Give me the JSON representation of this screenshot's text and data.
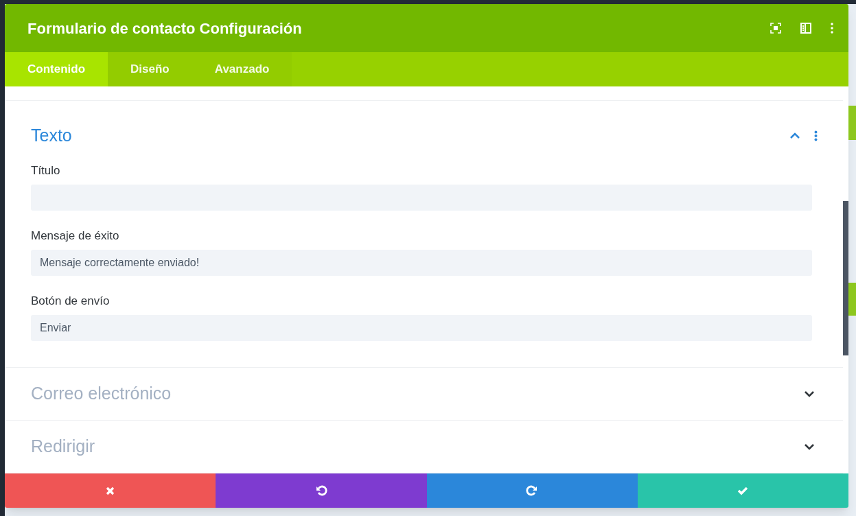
{
  "window": {
    "title": "Formulario de contacto Configuración"
  },
  "tabs": [
    {
      "label": "Contenido",
      "selected": true
    },
    {
      "label": "Diseño",
      "selected": false
    },
    {
      "label": "Avanzado",
      "selected": false
    }
  ],
  "sections": [
    {
      "title": "Texto",
      "expanded": true,
      "fields": [
        {
          "label": "Título"
        },
        {
          "label": "Mensaje de éxito",
          "value": "Mensaje correctamente enviado!"
        },
        {
          "label": "Botón de envío",
          "value": "Enviar"
        }
      ]
    },
    {
      "title": "Correo electrónico",
      "expanded": false
    },
    {
      "title": "Redirigir",
      "expanded": false
    }
  ]
}
